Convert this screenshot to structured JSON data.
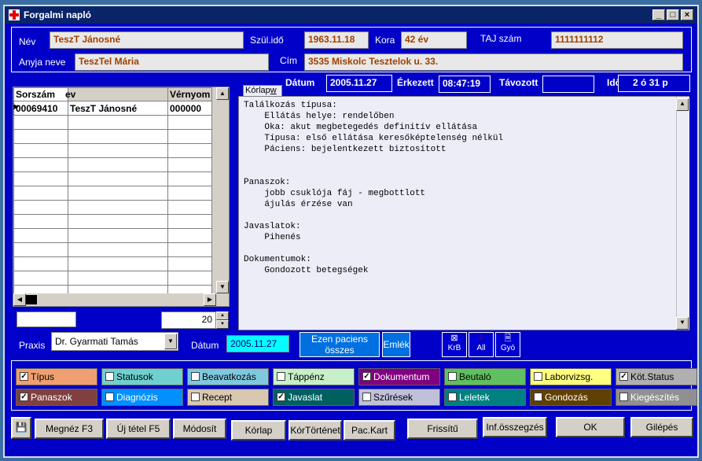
{
  "window": {
    "title": "Forgalmi napló",
    "min": "_",
    "max": "□",
    "close": "×"
  },
  "patient": {
    "name_label": "Név",
    "name": "TeszT Jánosné",
    "birth_label": "Szül.idő",
    "birth": "1963.11.18",
    "age_label": "Kora",
    "age": "42 év",
    "taj_label": "TAJ szám",
    "taj": "1111111112",
    "mother_label": "Anyja neve",
    "mother": "TeszTel Mária",
    "address_label": "Cím",
    "address": "3535 Miskolc Tesztelok u. 33."
  },
  "visit": {
    "date_label": "Dátum",
    "date": "2005.11.27",
    "arrived_label": "Érkezett",
    "arrived": "08:47:19",
    "left_label": "Távozott",
    "left": "",
    "time_label": "Idő",
    "time": "2 ó 31 p"
  },
  "grid": {
    "columns": [
      "Sorszám",
      "Név",
      "Vérnyom"
    ],
    "rows": [
      [
        "00069410",
        "TeszT Jánosné",
        "000000"
      ]
    ],
    "filter_value": "",
    "spinner_value": "20"
  },
  "korlap_tab": "Kórlap",
  "korlap_tab_suffix": "w",
  "memo_text": "Találkozás típusa:\n    Ellátás helye: rendelőben\n    Oka: akut megbetegedés definitív ellátása\n    Típusa: első ellátása keresőképtelenség nélkül\n    Páciens: bejelentkezett biztosított\n\n\nPanaszok:\n    jobb csuklója fáj - megbottlott\n    ájulás érzése van\n\nJavaslatok:\n    Pihenés\n\nDokumentumok:\n    Gondozott betegségek",
  "praxis": {
    "label": "Praxis",
    "value": "Dr. Gyarmati Tamás",
    "date_label": "Dátum",
    "date": "2005.11.27"
  },
  "mid_buttons": {
    "all_patient": "Ezen paciens összes",
    "emlek": "Emlék",
    "krb": "KrB",
    "all": "All",
    "gyo": "Gyó"
  },
  "checkboxes": [
    {
      "label": "Típus",
      "checked": true,
      "color": "#f0a070"
    },
    {
      "label": "Statusok",
      "checked": false,
      "color": "#70d0d0"
    },
    {
      "label": "Beavatkozás",
      "checked": false,
      "color": "#80c8e0"
    },
    {
      "label": "Táppénz",
      "checked": false,
      "color": "#c8f0c8"
    },
    {
      "label": "Dokumentum",
      "checked": true,
      "color": "#800080"
    },
    {
      "label": "Beutaló",
      "checked": false,
      "color": "#60c060"
    },
    {
      "label": "Laborvizsg.",
      "checked": false,
      "color": "#ffff80"
    },
    {
      "label": "Köt.Status",
      "checked": true,
      "color": "#b0b0b0"
    },
    {
      "label": "Panaszok",
      "checked": true,
      "color": "#804040"
    },
    {
      "label": "Diagnózis",
      "checked": false,
      "color": "#0090ff"
    },
    {
      "label": "Recept",
      "checked": false,
      "color": "#d8c8b0"
    },
    {
      "label": "Javaslat",
      "checked": true,
      "color": "#006060"
    },
    {
      "label": "Szűrések",
      "checked": false,
      "color": "#c0c0d8"
    },
    {
      "label": "Leletek",
      "checked": false,
      "color": "#008080"
    },
    {
      "label": "Gondozás",
      "checked": false,
      "color": "#604000"
    },
    {
      "label": "Kiegészítés",
      "checked": false,
      "color": "#909090"
    }
  ],
  "bottom_buttons": [
    "Megnéz F3",
    "Új tétel F5",
    "Módosít",
    "Kórlap",
    "KórTörténet",
    "Pac.Kart",
    "Frissítű",
    "Inf.összegzés",
    "OK",
    "Gilépés"
  ]
}
